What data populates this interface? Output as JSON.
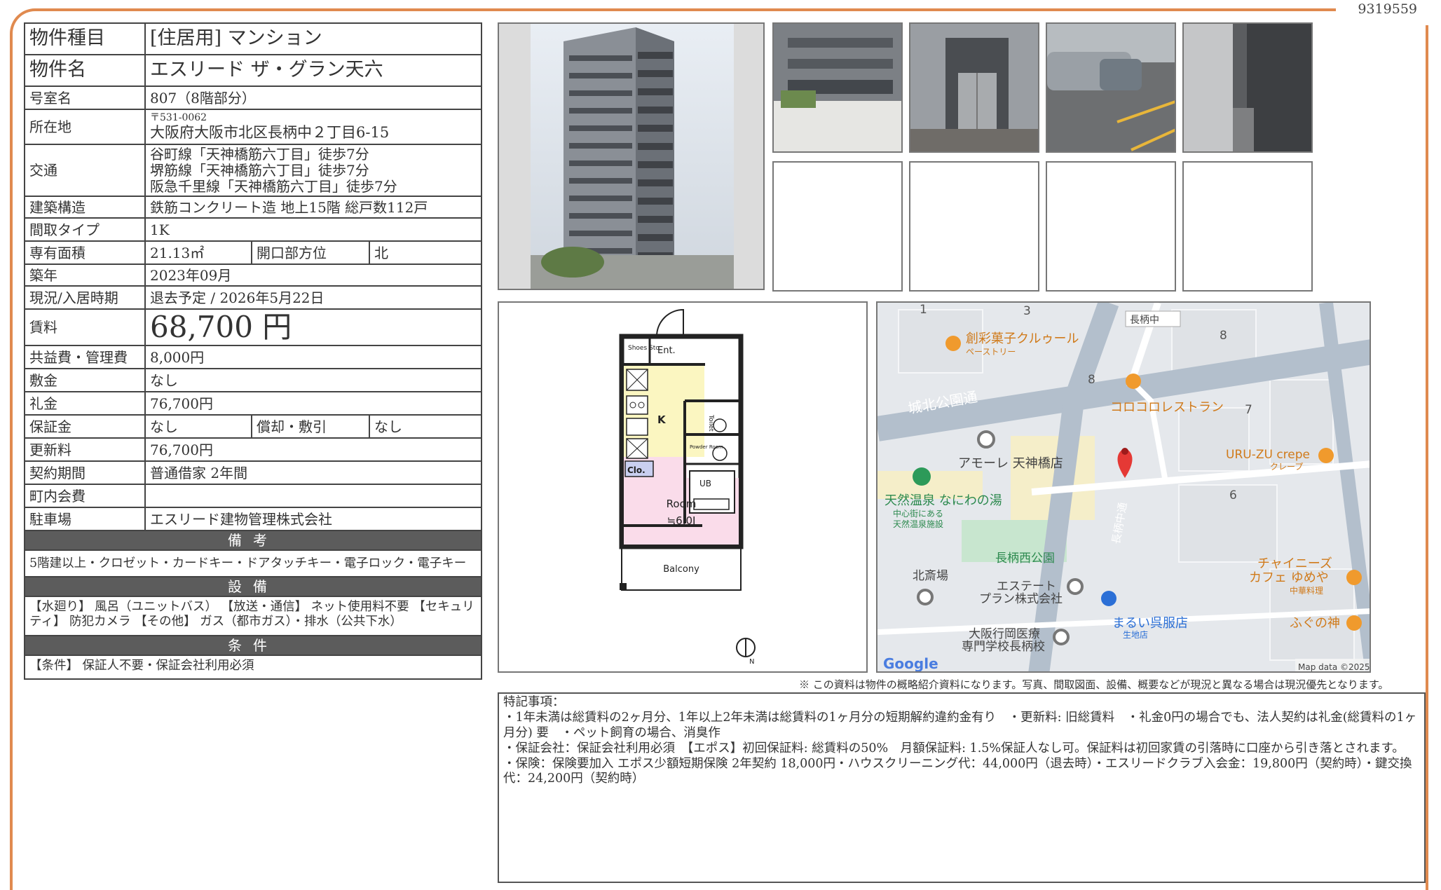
{
  "ref_no": "9319559",
  "property": {
    "rows": [
      {
        "key": "物件種目",
        "value": "[住居用]  マンション"
      },
      {
        "key": "物件名",
        "value": "エスリード ザ・グラン天六"
      },
      {
        "key": "号室名",
        "value": "807（8階部分）"
      },
      {
        "key": "所在地",
        "postal": "〒531-0062",
        "value": "大阪府大阪市北区長柄中２丁目6-15"
      },
      {
        "key": "交通",
        "lines": [
          "谷町線「天神橋筋六丁目」徒歩7分",
          "堺筋線「天神橋筋六丁目」徒歩7分",
          "阪急千里線「天神橋筋六丁目」徒歩7分"
        ]
      },
      {
        "key": "建築構造",
        "value": "鉄筋コンクリート造 地上15階 総戸数112戸"
      },
      {
        "key": "間取タイプ",
        "value": "1K"
      },
      {
        "key": "専有面積",
        "value": "21.13㎡",
        "key2": "開口部方位",
        "value2": "北"
      },
      {
        "key": "築年",
        "value": "2023年09月"
      },
      {
        "key": "現況/入居時期",
        "value": "退去予定 /  2026年5月22日"
      },
      {
        "key": "賃料",
        "value": "68,700 円"
      },
      {
        "key": "共益費・管理費",
        "value": "8,000円"
      },
      {
        "key": "敷金",
        "value": "なし"
      },
      {
        "key": "礼金",
        "value": "76,700円"
      },
      {
        "key": "保証金",
        "value": "なし",
        "key2": "償却・敷引",
        "value2": "なし"
      },
      {
        "key": "更新料",
        "value": "76,700円"
      },
      {
        "key": "契約期間",
        "value": "普通借家 2年間"
      },
      {
        "key": "町内会費",
        "value": ""
      },
      {
        "key": "駐車場",
        "value": "エスリード建物管理株式会社"
      }
    ],
    "biko_title": "備考",
    "biko_text": "5階建以上・クロゼット・カードキー・ドアタッチキー・電子ロック・電子キー",
    "setsubi_title": "設備",
    "setsubi_text": "【水廻り】 風呂（ユニットバス） 【放送・通信】 ネット使用料不要 【セキュリティ】 防犯カメラ 【その他】 ガス（都市ガス）・排水（公共下水）",
    "joken_title": "条件",
    "joken_text": "【条件】 保証人不要・保証会社利用必須"
  },
  "floorplan": {
    "labels": {
      "shoes": "Shoes Sto.",
      "ent": "Ent.",
      "k": "K",
      "toilet": "Toilet",
      "powder": "Powder Room",
      "clo": "Clo.",
      "ub": "UB",
      "room": "Room",
      "room_size": "≒6.0J",
      "balcony": "Balcony",
      "north": "N"
    }
  },
  "map": {
    "labels": {
      "n1": "1",
      "n3": "3",
      "n8a": "8",
      "n8b": "8",
      "n7": "7",
      "n6": "6",
      "nagarachu": "長柄中",
      "sousai": "創彩菓子クルゥール",
      "sousai_sub": "ペーストリー",
      "johoku": "城北公園通",
      "korokoro": "コロコロレストラン",
      "amore": "アモーレ 天神橋店",
      "uruzu": "URU-ZU crepe",
      "uruzu_sub": "クレープ",
      "onsen": "天然温泉 なにわの湯",
      "onsen_sub1": "中心街にある",
      "onsen_sub2": "天然温泉施設",
      "nagarachu_dori": "長柄中通",
      "park": "長柄西公園",
      "kitasaiba": "北斎場",
      "estate1": "エステート",
      "estate2": "プラン株式会社",
      "chinese1": "チャイニーズ",
      "chinese2": "カフェ ゆめや",
      "chinese_sub": "中華料理",
      "marui": "まるい呉服店",
      "marui_sub": "生地店",
      "fugu": "ふぐの神",
      "school1": "大阪行岡医療",
      "school2": "専門学校長柄校",
      "google": "Google",
      "mapdata": "Map data ©2025"
    }
  },
  "disclaimer": "※ この資料は物件の概略紹介資料になります。写真、間取図面、設備、概要などが現況と異なる場合は現況優先となります。",
  "remarks": {
    "title": "特記事項：",
    "lines": [
      "・1年未満は総賃料の2ヶ月分、1年以上2年未満は総賃料の1ヶ月分の短期解約違約金有り　・更新料: 旧総賃料　・礼金0円の場合でも、法人契約は礼金(総賃料の1ヶ月分) 要　・ペット飼育の場合、消臭作",
      "・保証会社：保証会社利用必須　【エポス】初回保証料: 総賃料の50%　月額保証料: 1.5%保証人なし可。保証料は初回家賃の引落時に口座から引き落とされます。",
      "・保険：保険要加入 エポス少額短期保険 2年契約 18,000円・ハウスクリーニング代：44,000円（退去時）・エスリードクラブ入会金：19,800円（契約時）・鍵交換代：24,200円（契約時）"
    ]
  }
}
